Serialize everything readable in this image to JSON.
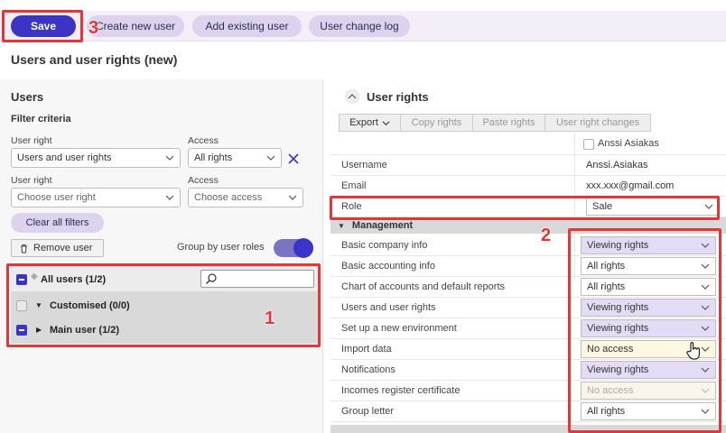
{
  "toolbar": {
    "save": "Save",
    "create_user": "Create new user",
    "add_existing": "Add existing user",
    "change_log": "User change log"
  },
  "page": {
    "title": "Users and user rights (new)"
  },
  "left": {
    "title": "Users",
    "filter_title": "Filter criteria",
    "filters": [
      {
        "label": "User right",
        "value": "Users and user rights",
        "access_label": "Access",
        "access_value": "All rights"
      },
      {
        "label": "User right",
        "placeholder": "Choose user right",
        "access_label": "Access",
        "access_placeholder": "Choose access"
      }
    ],
    "clear_filters": "Clear all filters",
    "remove_user": "Remove user",
    "group_by": "Group by user roles",
    "tree": [
      {
        "label": "All users (1/2)"
      },
      {
        "label": "Customised (0/0)"
      },
      {
        "label": "Main user (1/2)"
      }
    ]
  },
  "right": {
    "title": "User rights",
    "tabs": [
      "Export",
      "Copy rights",
      "Paste rights",
      "User right changes"
    ],
    "user_name": "Anssi Asiakas",
    "fields": [
      {
        "key": "Username",
        "value": "Anssi.Asiakas"
      },
      {
        "key": "Email",
        "value": "xxx.xxx@gmail.com"
      },
      {
        "key": "Role",
        "value": "Sale"
      }
    ],
    "section": "Management",
    "rights": [
      {
        "key": "Basic company info",
        "value": "Viewing rights"
      },
      {
        "key": "Basic accounting info",
        "value": "All rights"
      },
      {
        "key": "Chart of accounts and default reports",
        "value": "All rights"
      },
      {
        "key": "Users and user rights",
        "value": "Viewing rights"
      },
      {
        "key": "Set up a new environment",
        "value": "Viewing rights"
      },
      {
        "key": "Import data",
        "value": "No access"
      },
      {
        "key": "Notifications",
        "value": "Viewing rights"
      },
      {
        "key": "Incomes register certificate",
        "value": "No access"
      },
      {
        "key": "Group letter",
        "value": "All rights"
      }
    ]
  },
  "annotations": [
    "1",
    "2",
    "3"
  ],
  "colors": {
    "accent": "#3b34c7",
    "pill": "#ddd3ee",
    "highlight": "#e0383a"
  }
}
